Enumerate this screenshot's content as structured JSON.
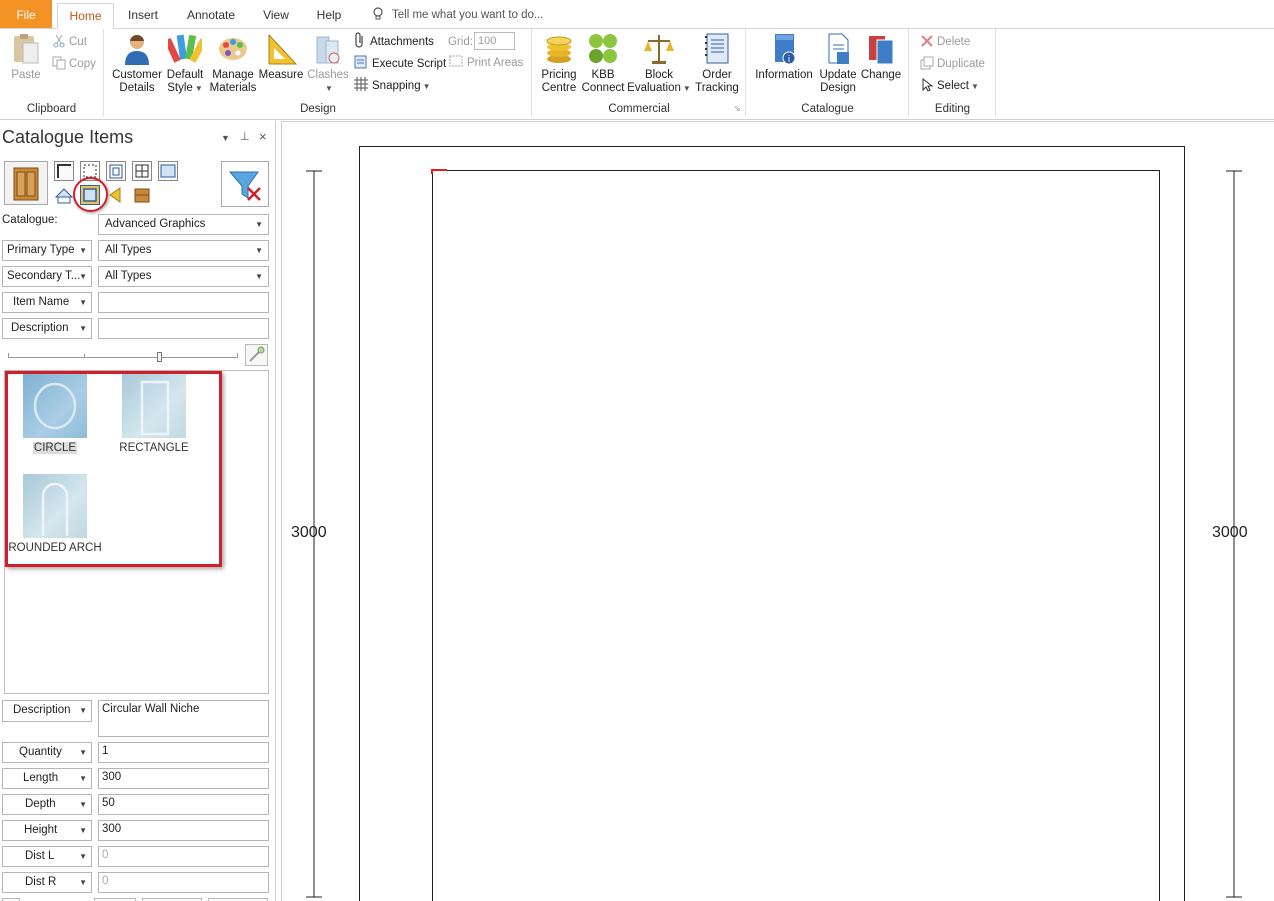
{
  "tabs": {
    "file": "File",
    "home": "Home",
    "insert": "Insert",
    "annotate": "Annotate",
    "view": "View",
    "help": "Help",
    "tell_me": "Tell me what you want to do..."
  },
  "ribbon": {
    "clipboard": {
      "label": "Clipboard",
      "paste": "Paste",
      "cut": "Cut",
      "copy": "Copy"
    },
    "design": {
      "label": "Design",
      "customer_details": [
        "Customer",
        "Details"
      ],
      "default_style": [
        "Default",
        "Style"
      ],
      "manage_materials": [
        "Manage",
        "Materials"
      ],
      "measure": "Measure",
      "clashes": "Clashes",
      "attachments": "Attachments",
      "execute_script": "Execute Script",
      "snapping": "Snapping",
      "grid_label": "Grid:",
      "grid_value": "100",
      "print_areas": "Print Areas"
    },
    "commercial": {
      "label": "Commercial",
      "pricing_centre": [
        "Pricing",
        "Centre"
      ],
      "kbb_connect": [
        "KBB",
        "Connect"
      ],
      "block_evaluation": [
        "Block",
        "Evaluation"
      ],
      "order_tracking": [
        "Order",
        "Tracking"
      ]
    },
    "catalogue": {
      "label": "Catalogue",
      "information": "Information",
      "update_design": [
        "Update",
        "Design"
      ],
      "change": "Change"
    },
    "editing": {
      "label": "Editing",
      "delete": "Delete",
      "duplicate": "Duplicate",
      "select": "Select"
    }
  },
  "panel": {
    "title": "Catalogue Items",
    "catalogue_label": "Catalogue:",
    "catalogue_value": "Advanced Graphics",
    "primary_type_label": "Primary Type",
    "primary_type_value": "All Types",
    "secondary_type_label": "Secondary T...",
    "secondary_type_value": "All Types",
    "item_name_label": "Item Name",
    "item_name_value": "",
    "description_filter_label": "Description",
    "description_filter_value": "",
    "items": [
      {
        "name": "CIRCLE"
      },
      {
        "name": "RECTANGLE"
      },
      {
        "name": "ROUNDED ARCH"
      }
    ],
    "properties": {
      "description_label": "Description",
      "description_value": "Circular Wall Niche",
      "quantity_label": "Quantity",
      "quantity_value": "1",
      "length_label": "Length",
      "length_value": "300",
      "depth_label": "Depth",
      "depth_value": "50",
      "height_label": "Height",
      "height_value": "300",
      "dist_l_label": "Dist L",
      "dist_l_value": "0",
      "dist_r_label": "Dist R",
      "dist_r_value": "0"
    }
  },
  "canvas": {
    "left_dimension": "3000",
    "right_dimension": "3000"
  },
  "colors": {
    "file_tab": "#f39325",
    "home_tab_text": "#c2571a",
    "highlight": "#d21e2a"
  }
}
